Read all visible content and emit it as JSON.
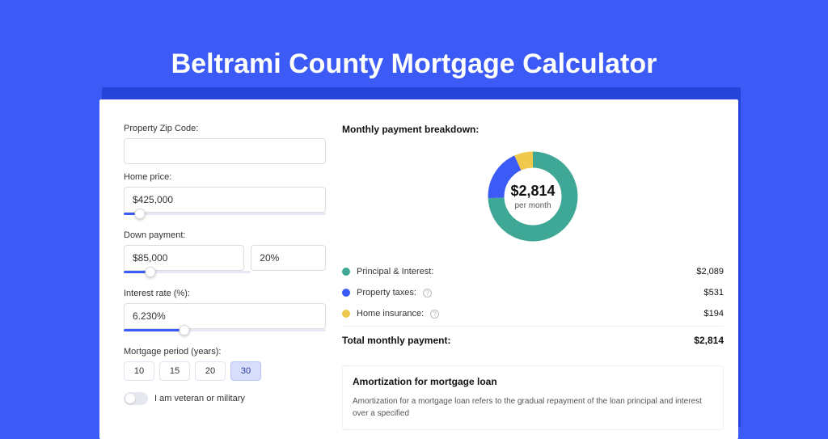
{
  "title": "Beltrami County Mortgage Calculator",
  "form": {
    "zip": {
      "label": "Property Zip Code:",
      "value": ""
    },
    "home_price": {
      "label": "Home price:",
      "value": "$425,000",
      "slider_pct": 8
    },
    "down_payment": {
      "label": "Down payment:",
      "amount": "$85,000",
      "percent": "20%",
      "slider_pct": 21
    },
    "interest": {
      "label": "Interest rate (%):",
      "value": "6.230%",
      "slider_pct": 30
    },
    "period": {
      "label": "Mortgage period (years):",
      "options": [
        "10",
        "15",
        "20",
        "30"
      ],
      "selected": "30"
    },
    "veteran": {
      "label": "I am veteran or military",
      "on": false
    }
  },
  "breakdown": {
    "title": "Monthly payment breakdown:",
    "center_amount": "$2,814",
    "center_sub": "per month",
    "items": [
      {
        "label": "Principal & Interest:",
        "value": "$2,089",
        "color": "green",
        "help": false
      },
      {
        "label": "Property taxes:",
        "value": "$531",
        "color": "blue",
        "help": true
      },
      {
        "label": "Home insurance:",
        "value": "$194",
        "color": "yellow",
        "help": true
      }
    ],
    "total_label": "Total monthly payment:",
    "total_value": "$2,814"
  },
  "amort": {
    "title": "Amortization for mortgage loan",
    "text": "Amortization for a mortgage loan refers to the gradual repayment of the loan principal and interest over a specified"
  },
  "chart_data": {
    "type": "pie",
    "title": "Monthly payment breakdown",
    "series": [
      {
        "name": "Principal & Interest",
        "value": 2089,
        "color": "#3FA796"
      },
      {
        "name": "Property taxes",
        "value": 531,
        "color": "#3C5AF5"
      },
      {
        "name": "Home insurance",
        "value": 194,
        "color": "#F0C94C"
      }
    ],
    "total": 2814,
    "unit": "USD per month"
  }
}
